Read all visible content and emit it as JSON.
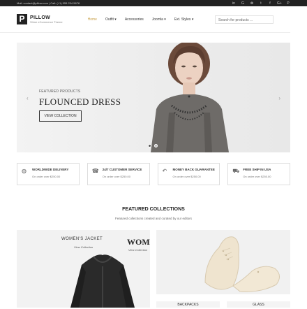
{
  "topbar": {
    "left": "Mail: contact@pillow.com  |  Call: (+1) 555 234 5678",
    "social": [
      "in",
      "G",
      "✿",
      "t",
      "f",
      "G+",
      "P"
    ]
  },
  "logo": {
    "letter": "P",
    "name": "PILLOW",
    "tagline": "Shine eCommerce Theme"
  },
  "nav": {
    "items": [
      "Home",
      "Outfit ▾",
      "Accessories",
      "Joomla ▾",
      "Ext. Styles ▾"
    ],
    "active_index": 0
  },
  "search": {
    "placeholder": "Search for products ..."
  },
  "hero": {
    "kicker": "FEATURED PRODUCTS",
    "title": "FLOUNCED DRESS",
    "button": "VIEW COLLECTION",
    "prev": "‹",
    "next": "›"
  },
  "features": [
    {
      "icon": "globe-icon",
      "glyph": "◍",
      "title": "WORLDWIDE DELIVERY",
      "sub": "On order over $250.00"
    },
    {
      "icon": "headset-icon",
      "glyph": "☎",
      "title": "24/7 CUSTOMER SERVICE",
      "sub": "On order over $250.00"
    },
    {
      "icon": "refund-icon",
      "glyph": "↶",
      "title": "MONEY BACK GUARANTEE",
      "sub": "On order over $250.00"
    },
    {
      "icon": "truck-icon",
      "glyph": "⛟",
      "title": "FREE SHIP IN USA",
      "sub": "On order over $250.00"
    }
  ],
  "collections": {
    "title": "FEATURED COLLECTIONS",
    "subtitle": "Featured collections created and curated by our editors",
    "jacket": {
      "label": "WOMEN'S JACKET",
      "link": "View Collection"
    },
    "shoes": {
      "label": "WOMEN'SHOES",
      "link": "View Collection"
    },
    "backpacks": "BACKPACKS",
    "glass": "GLASS"
  }
}
